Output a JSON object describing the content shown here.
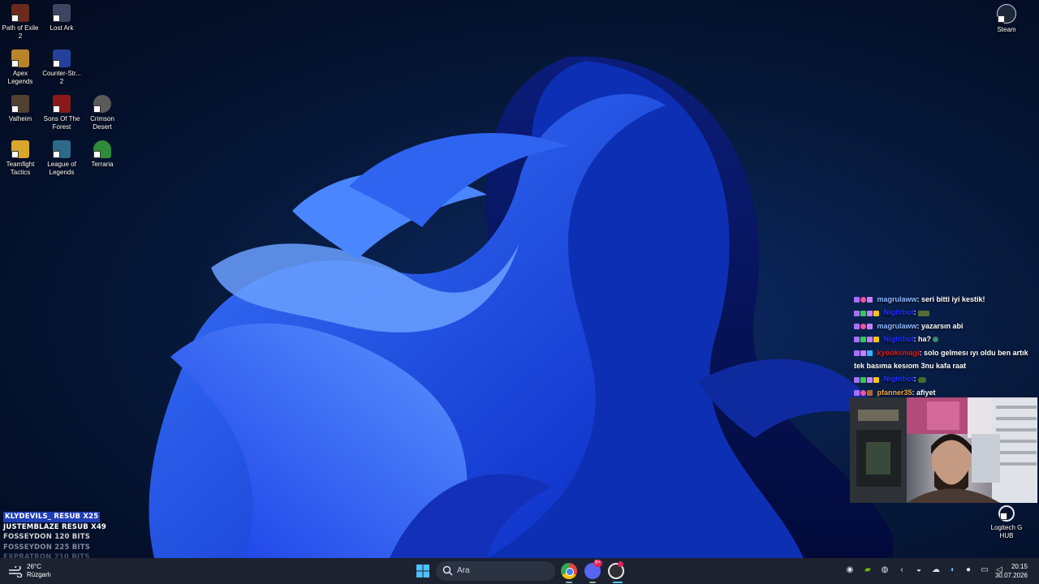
{
  "desktop": {
    "icons": [
      {
        "label": "Path of Exile 2",
        "icon": "path-of-exile-icon",
        "color": "#6b2a1d"
      },
      {
        "label": "Lost Ark",
        "icon": "lost-ark-icon",
        "color": "#3b4660"
      },
      {
        "label": "Apex Legends",
        "icon": "apex-legends-icon",
        "color": "#b8842a"
      },
      {
        "label": "Counter-Str... 2",
        "icon": "counter-strike-icon",
        "color": "#23419a"
      },
      {
        "label": "Valheim",
        "icon": "valheim-icon",
        "color": "#524030"
      },
      {
        "label": "Sons Of The Forest",
        "icon": "sons-of-the-forest-icon",
        "color": "#8a1a1a"
      },
      {
        "label": "Crimson Desert",
        "icon": "crimson-desert-icon",
        "color": "#5a5a5a"
      },
      {
        "label": "Teamfight Tactics",
        "icon": "teamfight-tactics-icon",
        "color": "#d9a82a"
      },
      {
        "label": "League of Legends",
        "icon": "league-of-legends-icon",
        "color": "#2d6a8a"
      },
      {
        "label": "Terraria",
        "icon": "terraria-icon",
        "color": "#2f8a3a"
      },
      {
        "label": "Steam",
        "icon": "steam-icon",
        "color": "#1b2838"
      },
      {
        "label": "Logitech G HUB",
        "icon": "logitech-ghub-icon",
        "color": "#e8e8e8"
      }
    ]
  },
  "chat": {
    "messages": [
      {
        "user": "magrulaww",
        "text": ": seri bitti iyi kestik!",
        "user_color": "#8fb8ff"
      },
      {
        "user": "Nightbot",
        "text": ": ",
        "user_color": "#1e2fff"
      },
      {
        "user": "magrulaww",
        "text": ": yazarsın abi",
        "user_color": "#8fb8ff"
      },
      {
        "user": "Nightbot",
        "text": ": ha?",
        "user_color": "#1e2fff"
      },
      {
        "user": "kyooksmagi",
        "text": ": solo gelmesı ıyı oldu ben artık tek basıma kesıom 3nu kafa raat",
        "user_color": "#e11d1d"
      },
      {
        "user": "Nightbot",
        "text": ": ",
        "user_color": "#1e2fff"
      },
      {
        "user": "pfanner35",
        "text": ": afiyet",
        "user_color": "#f0a83a"
      }
    ]
  },
  "alerts": [
    {
      "text": "KLYDEVILS_ RESUB X25",
      "color": "#ffffff",
      "highlight": true
    },
    {
      "text": "JUSTEMBLAZE RESUB X49",
      "color": "#ffffff",
      "highlight": false
    },
    {
      "text": "FOSSEYDON 120 BITS",
      "color": "#d0d0d0",
      "highlight": false
    },
    {
      "text": "FOSSEYDON 225 BITS",
      "color": "#7f8a99",
      "highlight": false
    },
    {
      "text": "EXPRATRON 210 BITS",
      "color": "#4a5566",
      "highlight": false
    }
  ],
  "taskbar": {
    "weather": {
      "temp": "26°C",
      "condition": "Rüzgarlı",
      "icon": "wind-icon"
    },
    "search_placeholder": "Ara",
    "apps": [
      {
        "name": "chrome-icon",
        "color": "#e8453c"
      },
      {
        "name": "discord-icon",
        "color": "#5865f2",
        "badge": "9+"
      },
      {
        "name": "obs-icon",
        "color": "#302e31"
      }
    ],
    "tray": [
      "steelseries-icon",
      "nvidia-icon",
      "steam-tray-icon",
      "chevron-icon",
      "discord-tray-icon",
      "cloud-icon",
      "edge-icon",
      "microphone-icon",
      "display-icon",
      "volume-icon"
    ],
    "clock": {
      "time": "20:15",
      "date": "30.07.2026"
    }
  }
}
